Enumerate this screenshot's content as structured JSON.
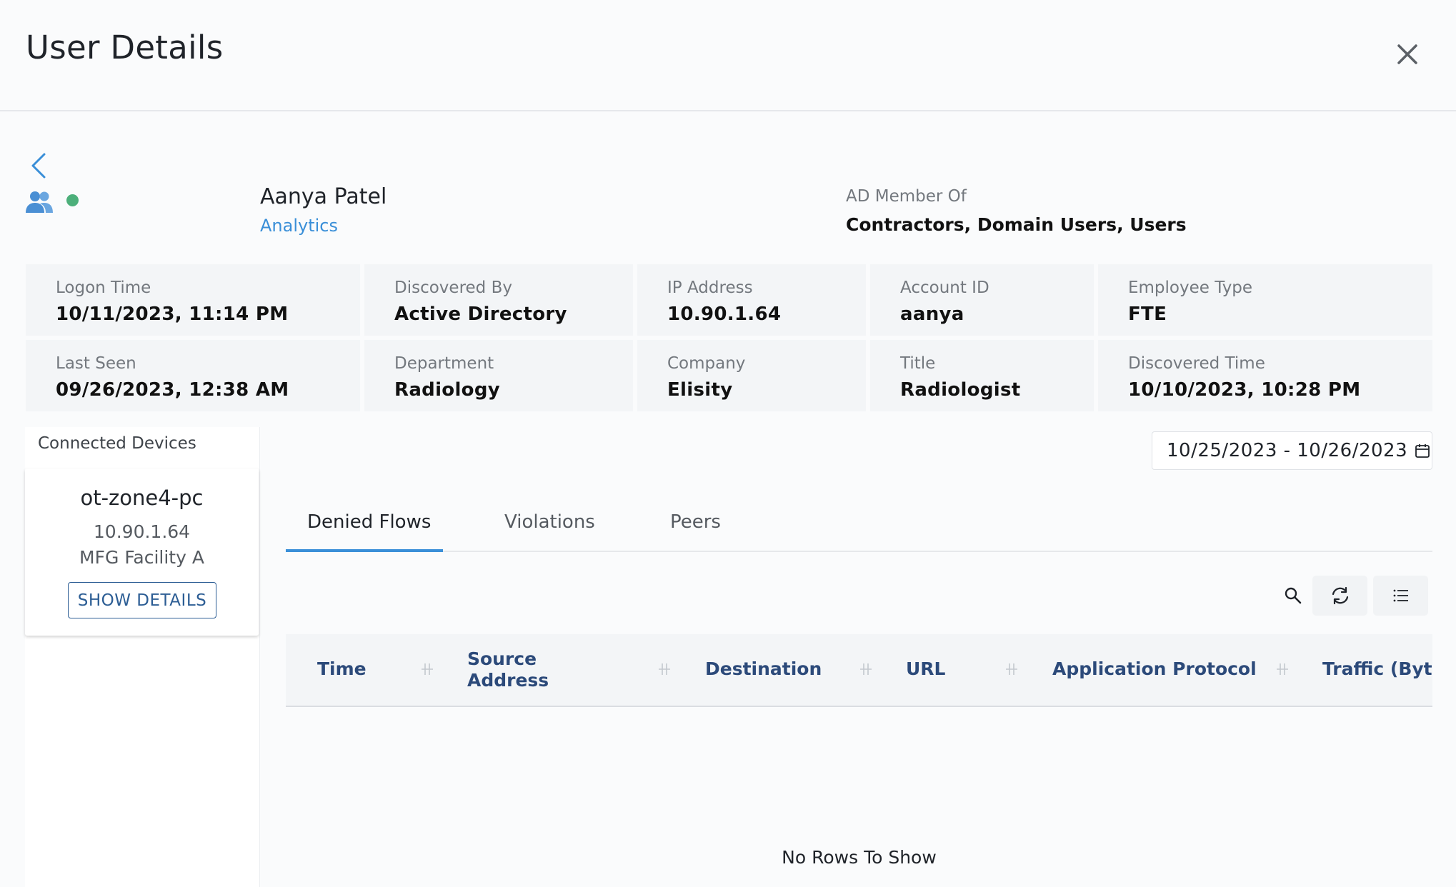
{
  "header": {
    "title": "User Details"
  },
  "user": {
    "name": "Aanya Patel",
    "department": "Analytics",
    "ad_label": "AD Member Of",
    "ad_value": "Contractors, Domain Users, Users",
    "status_color": "#4caf7a"
  },
  "info": {
    "logon_time": {
      "label": "Logon Time",
      "value": "10/11/2023, 11:14 PM"
    },
    "discovered_by": {
      "label": "Discovered By",
      "value": "Active Directory"
    },
    "ip_address": {
      "label": "IP Address",
      "value": "10.90.1.64"
    },
    "account_id": {
      "label": "Account ID",
      "value": "aanya"
    },
    "employee_type": {
      "label": "Employee Type",
      "value": "FTE"
    },
    "last_seen": {
      "label": "Last Seen",
      "value": "09/26/2023, 12:38 AM"
    },
    "department": {
      "label": "Department",
      "value": "Radiology"
    },
    "company": {
      "label": "Company",
      "value": "Elisity"
    },
    "title": {
      "label": "Title",
      "value": "Radiologist"
    },
    "discovered_time": {
      "label": "Discovered Time",
      "value": "10/10/2023, 10:28 PM"
    }
  },
  "devices": {
    "title": "Connected Devices",
    "items": [
      {
        "name": "ot-zone4-pc",
        "ip": "10.90.1.64",
        "site": "MFG Facility A",
        "button": "SHOW DETAILS"
      }
    ]
  },
  "date_range": {
    "value": "10/25/2023 - 10/26/2023",
    "icon": "calendar-icon"
  },
  "tabs": [
    {
      "label": "Denied Flows",
      "active": true
    },
    {
      "label": "Violations",
      "active": false
    },
    {
      "label": "Peers",
      "active": false
    }
  ],
  "toolbar": {
    "icons": [
      "search-icon",
      "refresh-icon",
      "columns-list-icon"
    ]
  },
  "table": {
    "columns": [
      "Time",
      "Source Address",
      "Destination",
      "URL",
      "Application Protocol",
      "Traffic (Bytes"
    ],
    "empty_text": "No Rows To Show"
  },
  "colors": {
    "accent": "#3a8fd8",
    "header_text": "#2c4a7a",
    "button_border": "#2c5d94"
  }
}
